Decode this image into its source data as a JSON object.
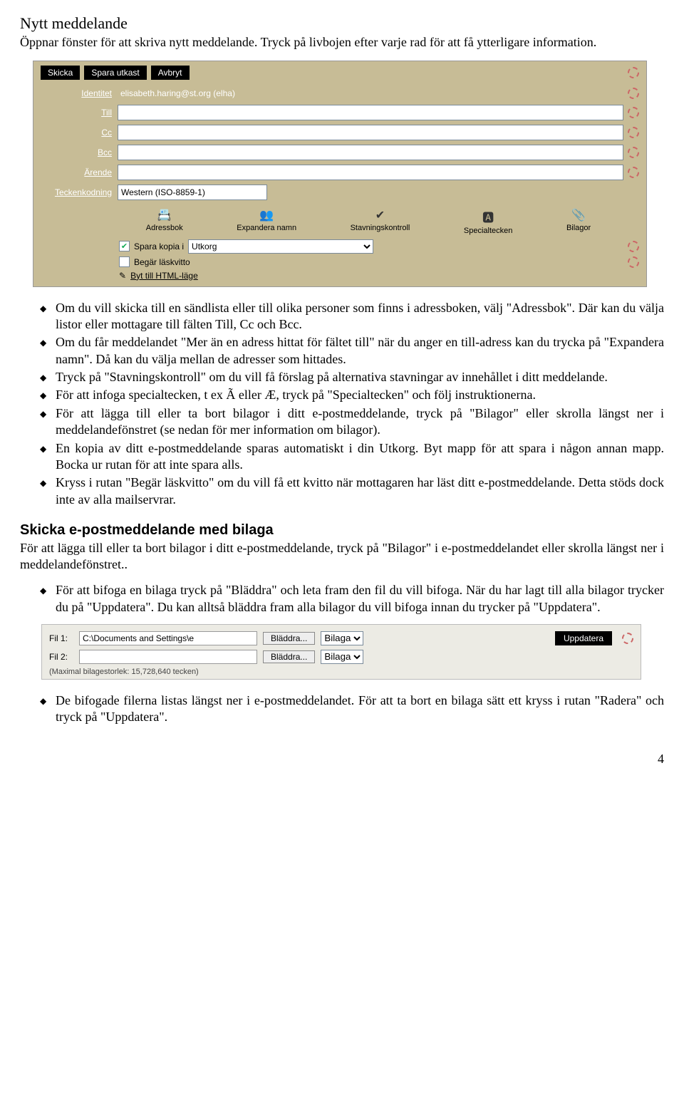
{
  "section": {
    "title": "Nytt meddelande",
    "lead": "Öppnar fönster för att skriva nytt meddelande. Tryck på livbojen efter varje rad för att få ytterligare information."
  },
  "compose": {
    "buttons": {
      "send": "Skicka",
      "draft": "Spara utkast",
      "cancel": "Avbryt"
    },
    "labels": {
      "identity": "Identitet",
      "to": "Till",
      "cc": "Cc",
      "bcc": "Bcc",
      "subject": "Ärende",
      "encoding": "Teckenkodning"
    },
    "values": {
      "identity": "elisabeth.haring@st.org (elha)",
      "to": "",
      "cc": "",
      "bcc": "",
      "subject": "",
      "encoding": "Western (ISO-8859-1)"
    },
    "toolbuttons": {
      "addressbook": "Adressbok",
      "expand": "Expandera namn",
      "spell": "Stavningskontroll",
      "special": "Specialtecken",
      "attach": "Bilagor"
    },
    "opts": {
      "savecopy_label": "Spara kopia i",
      "savecopy_folder": "Utkorg",
      "readreceipt": "Begär läskvitto",
      "html": "Byt till HTML-läge"
    }
  },
  "bullets_top": [
    "Om du vill skicka till en sändlista eller till olika personer som finns i adressboken, välj \"Adressbok\". Där kan du välja listor eller mottagare till fälten Till, Cc och Bcc.",
    "Om du får meddelandet \"Mer än en adress hittat för fältet till\" när du anger en till-adress kan du trycka på \"Expandera namn\". Då kan du välja mellan de adresser som hittades.",
    "Tryck på \"Stavningskontroll\" om du vill få förslag på alternativa stavningar av innehållet i ditt meddelande.",
    "För att infoga specialtecken, t ex Ã eller Æ, tryck på \"Specialtecken\" och följ instruktionerna.",
    "För att lägga till eller ta bort bilagor i ditt e-postmeddelande, tryck på \"Bilagor\" eller skrolla längst ner i meddelandefönstret (se nedan för mer information om bilagor).",
    "En kopia av ditt e-postmeddelande sparas automatiskt i din Utkorg. Byt mapp för att spara i någon annan mapp. Bocka ur rutan för att inte spara alls.",
    "Kryss i rutan \"Begär läskvitto\" om du vill få ett kvitto när mottagaren har läst ditt e-postmeddelande. Detta stöds dock inte av alla mailservrar."
  ],
  "section2": {
    "title": "Skicka e-postmeddelande med bilaga",
    "lead": "För att lägga till eller ta bort bilagor i ditt e-postmeddelande, tryck på \"Bilagor\" i e-postmeddelandet eller skrolla längst ner i meddelandefönstret.."
  },
  "bullets_mid": [
    "För att bifoga en bilaga tryck på \"Bläddra\" och leta fram den fil du vill bifoga. När du har lagt till alla bilagor trycker du på \"Uppdatera\". Du kan alltså bläddra fram alla bilagor du vill bifoga innan du trycker på \"Uppdatera\"."
  ],
  "attach": {
    "file_lbl1": "Fil 1:",
    "file_lbl2": "Fil 2:",
    "file1_val": "C:\\Documents and Settings\\e",
    "file2_val": "",
    "browse": "Bläddra...",
    "type": "Bilaga",
    "update": "Uppdatera",
    "note": "(Maximal bilagestorlek: 15,728,640 tecken)"
  },
  "bullets_bottom": [
    "De bifogade filerna listas längst ner i e-postmeddelandet. För att ta bort en bilaga sätt ett kryss i rutan \"Radera\" och tryck på \"Uppdatera\"."
  ],
  "page_number": "4"
}
